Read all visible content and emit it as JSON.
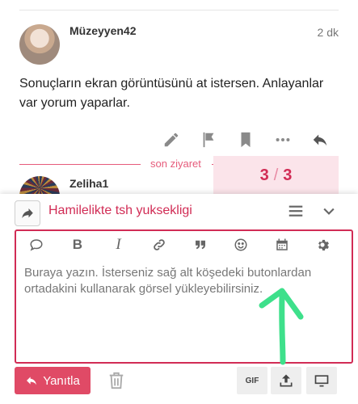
{
  "post": {
    "username": "Müzeyyen42",
    "time": "2 dk",
    "body": "Sonuçların ekran görüntüsünü at istersen. Anlayanlar var yorum yaparlar."
  },
  "separator": {
    "label": "son ziyaret"
  },
  "counter": {
    "current": "3",
    "slash": "/",
    "total": "3"
  },
  "next_post": {
    "username": "Zeliha1"
  },
  "composer": {
    "topic_title": "Hamilelikte tsh yuksekligi",
    "placeholder": "Buraya yazın. İsterseniz sağ alt köşedeki butonlardan ortadakini kullanarak görsel yükleyebilirsiniz.",
    "reply_label": "Yanıtla",
    "gif_label": "GIF"
  },
  "icons": {
    "post_actions": [
      "pencil-icon",
      "flag-icon",
      "bookmark-icon",
      "more-icon",
      "reply-icon"
    ],
    "toolbar": [
      "speech-bubble-icon",
      "bold-icon",
      "italic-icon",
      "link-icon",
      "quote-icon",
      "emoji-icon",
      "calendar-icon",
      "gear-icon"
    ]
  },
  "colors": {
    "accent": "#d12c55",
    "reply_button": "#e04a66",
    "annotation_arrow": "#3ee08b"
  }
}
